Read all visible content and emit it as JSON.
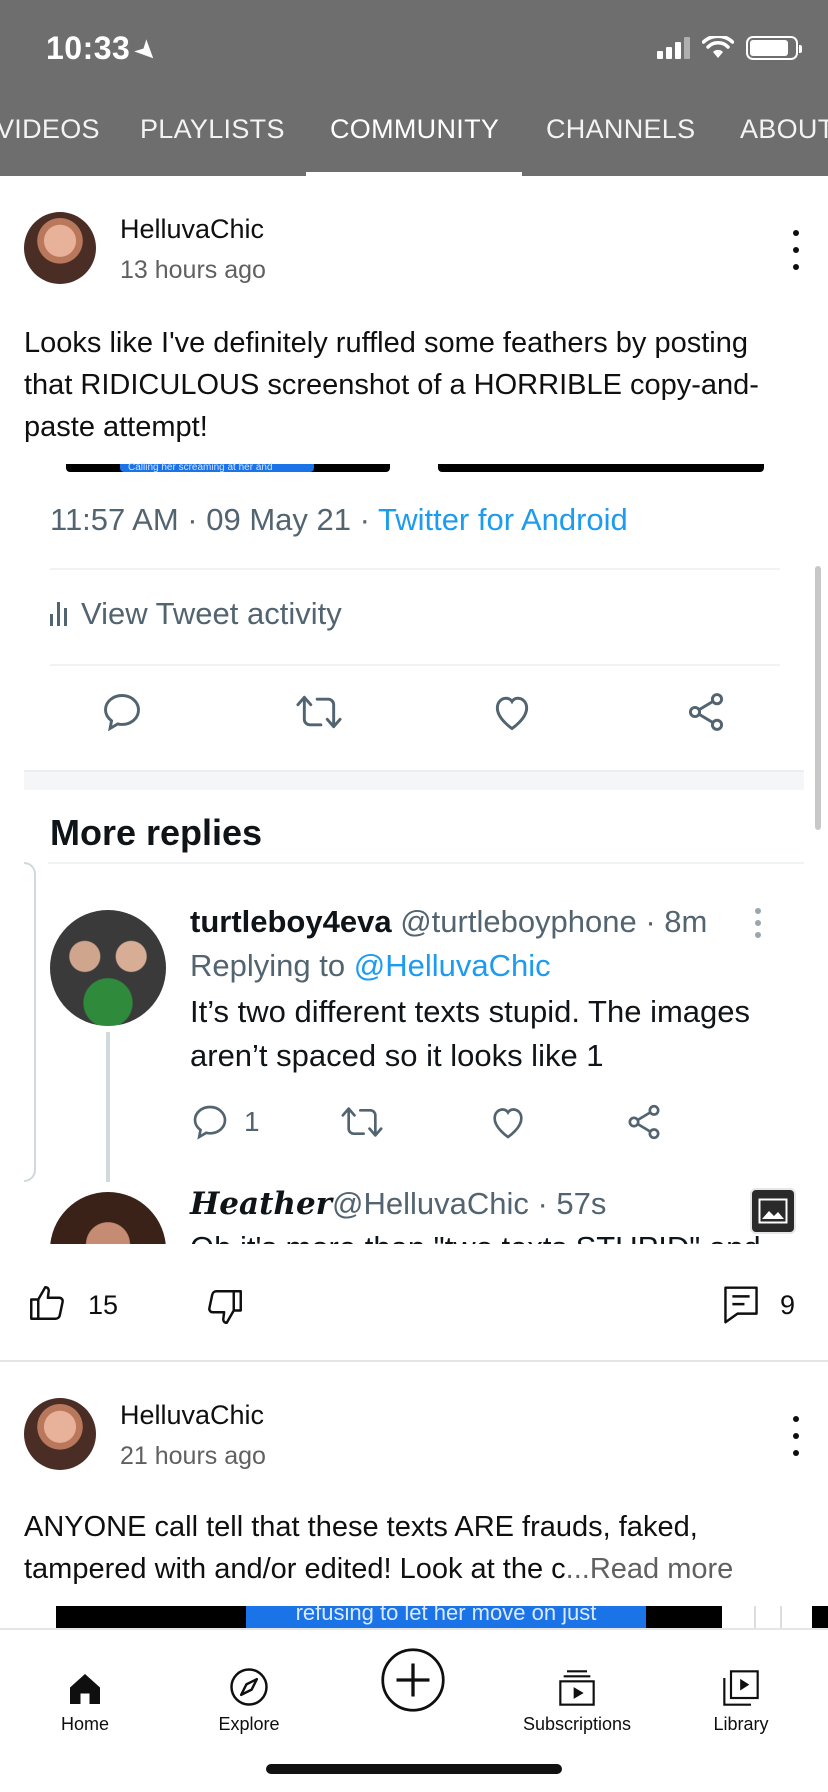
{
  "status_bar": {
    "time": "10:33"
  },
  "tabs": [
    {
      "label": "VIDEOS"
    },
    {
      "label": "PLAYLISTS"
    },
    {
      "label": "COMMUNITY",
      "active": true
    },
    {
      "label": "CHANNELS"
    },
    {
      "label": "ABOUT"
    }
  ],
  "post1": {
    "channel": "HelluvaChic",
    "time": "13 hours ago",
    "text": "Looks like I've definitely ruffled some feathers by posting that RIDICULOUS screenshot of a HORRIBLE copy-and-paste attempt!",
    "embed": {
      "strip_text": "Calling her screaming at her and",
      "tweet_time": "11:57 AM · 09 May 21 · ",
      "tweet_source": "Twitter for Android",
      "activity_label": "View Tweet activity",
      "more_replies_label": "More replies",
      "reply1": {
        "name": "turtleboy4eva",
        "handle_time": " @turtleboyphone · 8m",
        "replying_prefix": "Replying to ",
        "replying_handle": "@HelluvaChic",
        "text": "It’s two different texts stupid. The images aren’t spaced so it looks like 1",
        "reply_count": "1"
      },
      "reply2": {
        "name": "Heather",
        "handle_time": "@HelluvaChic · 57s",
        "text": "Oh it's more than \"two texts STUPID\" and"
      }
    },
    "likes": "15",
    "comments": "9"
  },
  "post2": {
    "channel": "HelluvaChic",
    "time": "21 hours ago",
    "text": "ANYONE call tell that these texts ARE frauds, faked, tampered with and/or edited! Look at the c",
    "read_more": "...Read more",
    "embed_text": "refusing to let her move on  just"
  },
  "bottom_nav": [
    {
      "label": "Home",
      "icon": "home-icon"
    },
    {
      "label": "Explore",
      "icon": "compass-icon"
    },
    {
      "label": "",
      "icon": "create-plus-icon"
    },
    {
      "label": "Subscriptions",
      "icon": "subscriptions-icon"
    },
    {
      "label": "Library",
      "icon": "library-icon"
    }
  ],
  "colors": {
    "header": "#6e6e6e",
    "twitter_blue": "#1d9bf0",
    "muted": "#606060"
  }
}
